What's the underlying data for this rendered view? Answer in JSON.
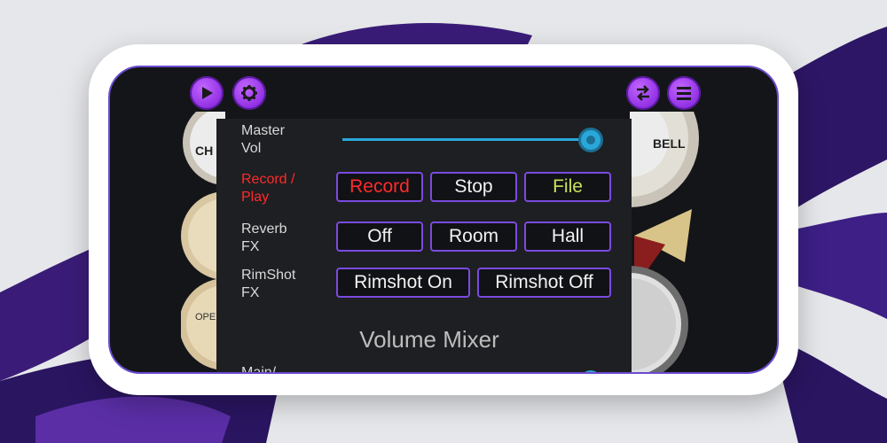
{
  "header": {
    "play_icon": "play-icon",
    "settings_icon": "gear-icon",
    "swap_icon": "swap-arrows-icon",
    "menu_icon": "hamburger-menu-icon"
  },
  "drum_labels": {
    "left_top": "CH",
    "left_bottom": "OPE",
    "right_top": "BELL"
  },
  "controls": {
    "master_vol": {
      "label": "Master\nVol",
      "value_percent": 100
    },
    "record_play": {
      "label": "Record /\nPlay",
      "buttons": [
        "Record",
        "Stop",
        "File"
      ]
    },
    "reverb": {
      "label": "Reverb\nFX",
      "buttons": [
        "Off",
        "Room",
        "Hall"
      ]
    },
    "rimshot": {
      "label": "RimShot\nFX",
      "buttons": [
        "Rimshot On",
        "Rimshot Off"
      ]
    }
  },
  "mixer": {
    "title": "Volume Mixer",
    "partial_label": "Main/"
  },
  "colors": {
    "accent_purple": "#8e2de2",
    "button_border": "#7b4ae0",
    "record_red": "#ff2a2a",
    "file_green": "#c8e25a",
    "slider_blue": "#2aa7d9"
  }
}
